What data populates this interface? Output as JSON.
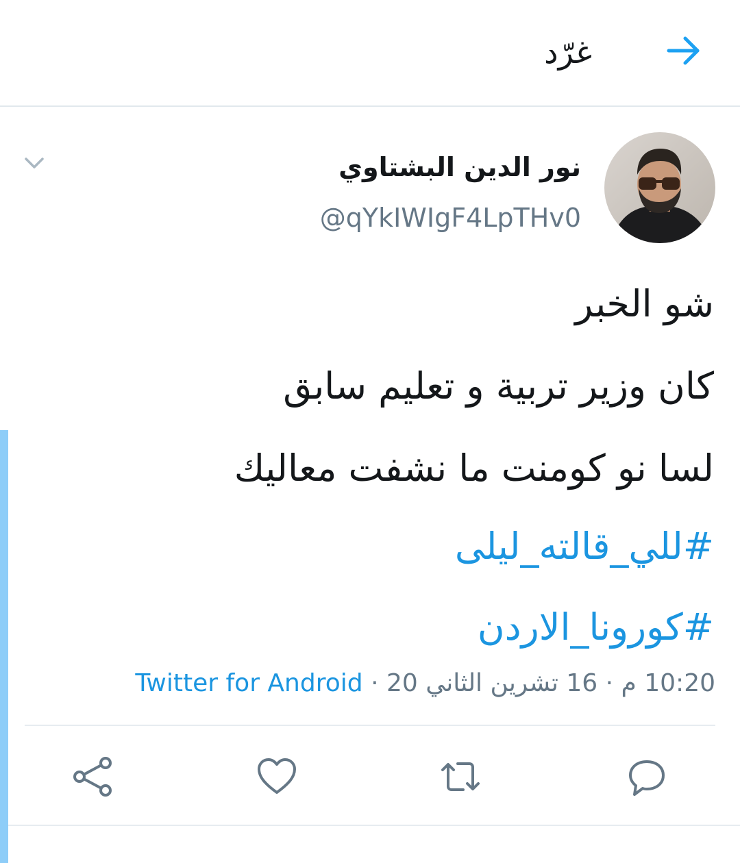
{
  "header": {
    "title": "غرّد",
    "back_icon": "arrow-right-icon",
    "accent_color": "#1da1f2"
  },
  "author": {
    "name": "نور الدين البشتاوي",
    "handle": "@qYkIWIgF4LpTHv0",
    "avatar_icon": "avatar-photo",
    "menu_icon": "chevron-down-icon"
  },
  "tweet": {
    "lines": [
      "شو الخبر",
      "كان وزير تربية و تعليم سابق",
      "لسا نو كومنت ما نشفت معاليك"
    ],
    "hashtags": [
      "#للي_قالته_ليلى",
      "#كورونا_الاردن"
    ],
    "hashtag_color": "#1b95e0"
  },
  "meta": {
    "time_date": "10:20 م · 16 تشرين الثاني 20 · ",
    "source": "Twitter for Android"
  },
  "actions": [
    {
      "name": "reply",
      "icon": "reply-icon"
    },
    {
      "name": "retweet",
      "icon": "retweet-icon"
    },
    {
      "name": "like",
      "icon": "heart-icon"
    },
    {
      "name": "share",
      "icon": "share-icon"
    }
  ]
}
